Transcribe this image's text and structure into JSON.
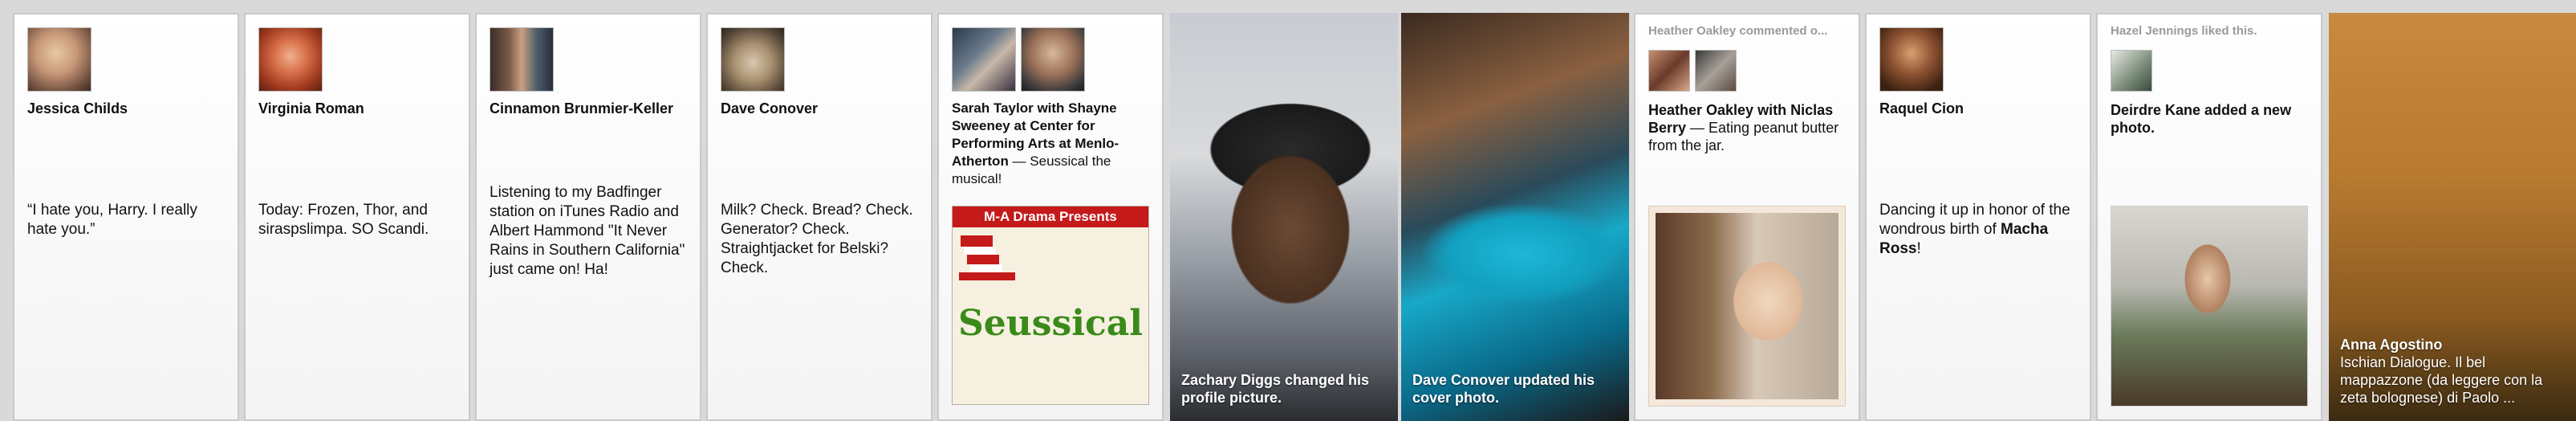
{
  "cards": [
    {
      "name": "Jessica Childs",
      "text": "“I hate you, Harry.  I really hate you.”"
    },
    {
      "name": "Virginia Roman",
      "text": "Today: Frozen, Thor, and siraspslimpa. SO Scandi."
    },
    {
      "name": "Cinnamon Brunmier-Keller",
      "text": "Listening to my Badfinger station on iTunes Radio and Albert Hammond \"It Never Rains in Southern California\" just came on! Ha!"
    },
    {
      "name": "Dave Conover",
      "text": "Milk? Check.  Bread? Check.  Generator? Check. Straightjacket for Belski? Check."
    },
    {
      "name": "Sarah Taylor with Shayne Sweeney at Center for Performing Arts at Menlo-Atherton",
      "rest": " — Seussical the musical!",
      "poster_title": "M-A Drama Presents",
      "poster_name": "Seussical"
    },
    {
      "caption": "Zachary Diggs changed his profile picture."
    },
    {
      "caption": "Dave Conover updated his cover photo."
    },
    {
      "header": "Heather Oakley commented o...",
      "name": "Heather Oakley with Niclas Berry",
      "rest": " — Eating peanut butter from the jar."
    },
    {
      "name": "Raquel Cion",
      "text_pre": "Dancing it up in honor of the wondrous birth of ",
      "text_bold": "Macha Ross",
      "text_post": "!"
    },
    {
      "header": "Hazel Jennings liked this.",
      "name": "Deirdre Kane added a new photo."
    },
    {
      "caption_name": "Anna Agostino",
      "caption_text": "Ischian Dialogue. Il bel mappazzone (da leggere con la zeta bolognese) di Paolo ..."
    }
  ],
  "colors": {
    "background": "#d9d9d9",
    "card": "#ffffff",
    "header_gray": "#9a9a9a",
    "text": "#111111"
  }
}
